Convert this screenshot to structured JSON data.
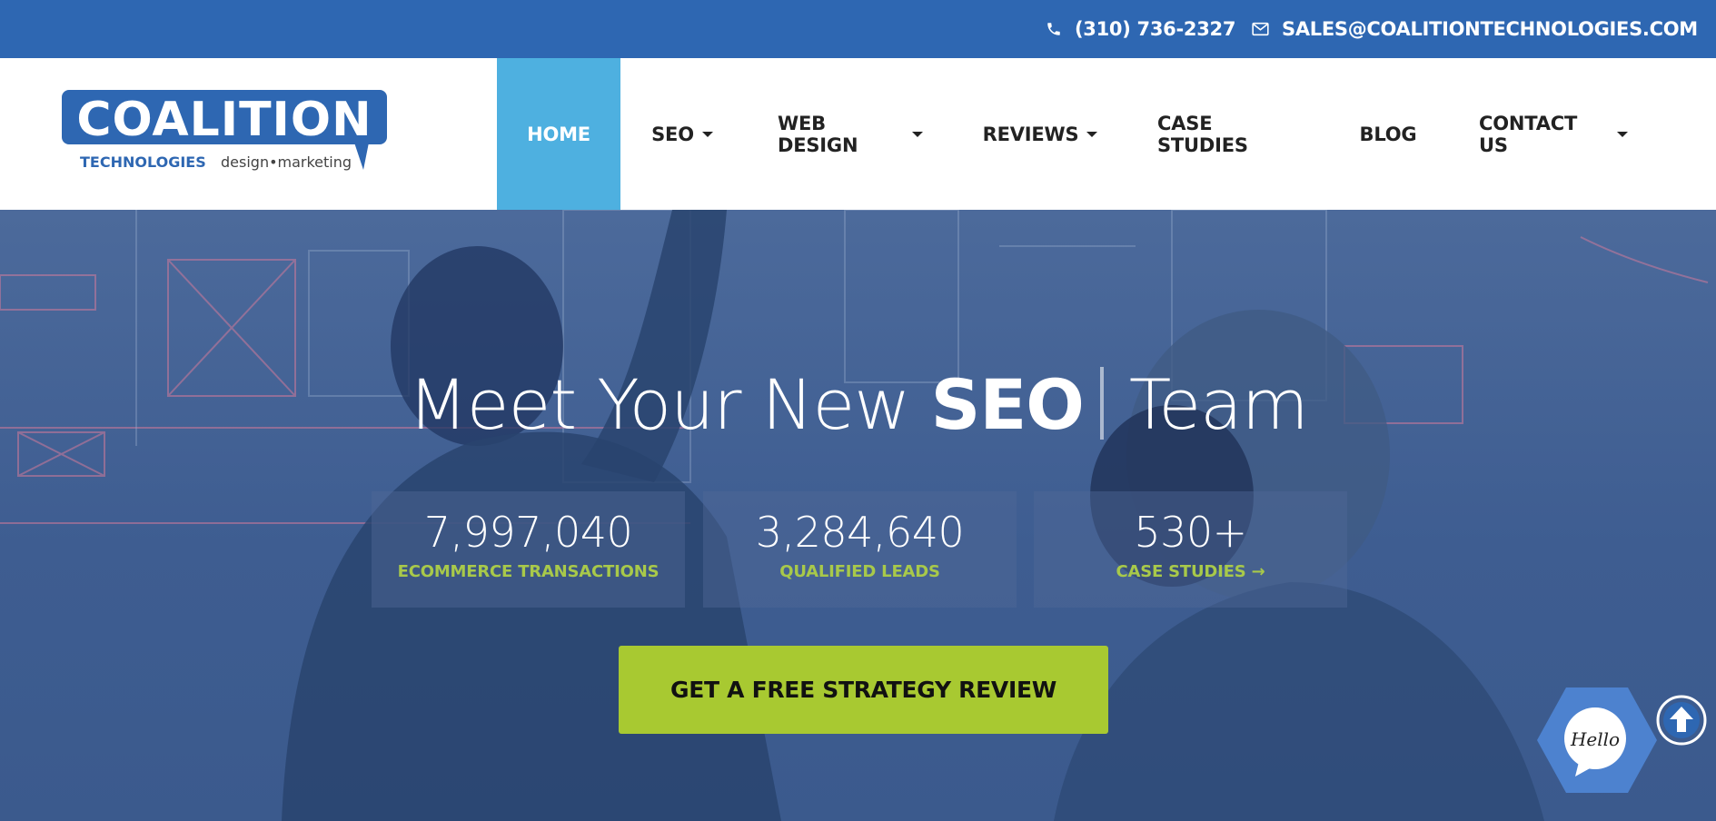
{
  "topbar": {
    "phone": "(310) 736-2327",
    "email": "SALES@COALITIONTECHNOLOGIES.COM",
    "icons": {
      "phone": "phone-icon",
      "email": "envelope-icon"
    }
  },
  "logo": {
    "wordmark": "COALITION",
    "sub_left": "TECHNOLOGIES",
    "sub_right": "design•marketing"
  },
  "nav": {
    "items": [
      {
        "label": "HOME",
        "active": true,
        "dropdown": false
      },
      {
        "label": "SEO",
        "dropdown": true
      },
      {
        "label": "WEB DESIGN",
        "dropdown": true
      },
      {
        "label": "REVIEWS",
        "dropdown": true
      },
      {
        "label": "CASE STUDIES",
        "dropdown": false
      },
      {
        "label": "BLOG",
        "dropdown": false
      },
      {
        "label": "CONTACT US",
        "dropdown": true
      }
    ]
  },
  "hero": {
    "headline_pre": "Meet Your New ",
    "headline_strong": "SEO",
    "headline_post": "Team",
    "stats": [
      {
        "value": "7,997,040",
        "label": "ECOMMERCE TRANSACTIONS"
      },
      {
        "value": "3,284,640",
        "label": "QUALIFIED LEADS"
      },
      {
        "value": "530+",
        "label": "CASE STUDIES →"
      }
    ],
    "cta_label": "GET A FREE STRATEGY REVIEW"
  },
  "widgets": {
    "chat_label": "Hello",
    "scroll_top_icon": "arrow-up-circle-icon"
  },
  "colors": {
    "topbar": "#2e67b2",
    "nav_active": "#4eb0e0",
    "accent_green": "#a8c931",
    "stat_label": "#a8c94a"
  }
}
